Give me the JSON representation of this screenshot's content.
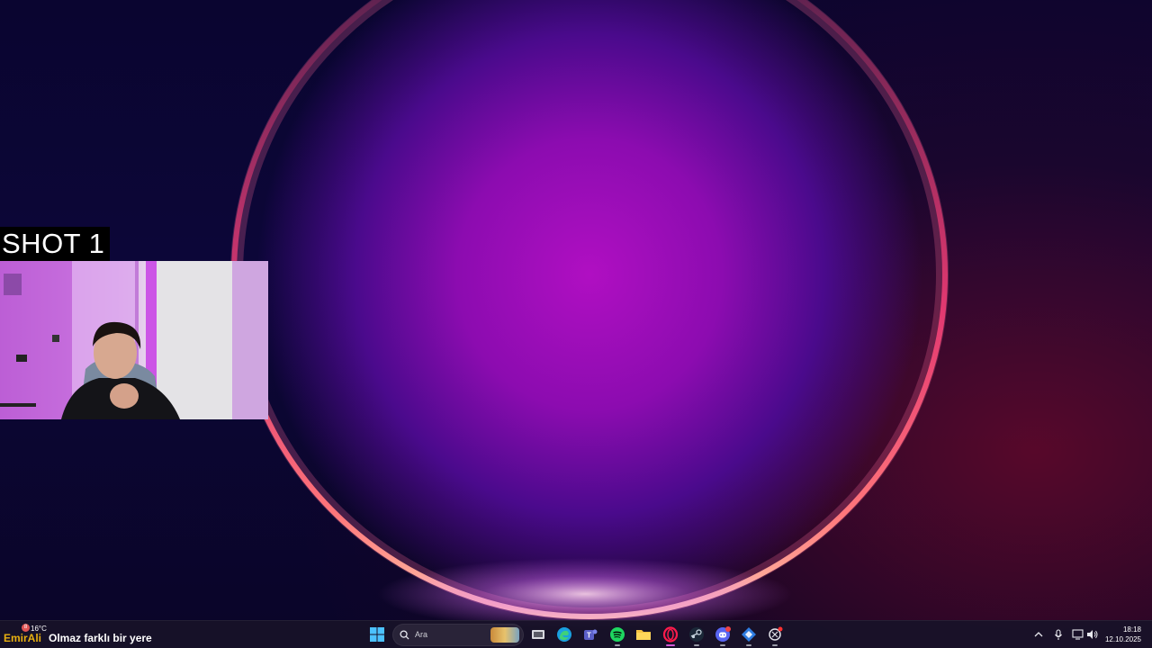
{
  "overlay": {
    "shot_label": "SHOT 1",
    "streamer_name": "EmirAli",
    "now_playing": "Olmaz farklı bir yere"
  },
  "weather": {
    "temperature": "16°C",
    "badge": "8"
  },
  "taskbar": {
    "search_placeholder": "Ara",
    "apps": [
      {
        "name": "start",
        "icon": "windows-icon"
      },
      {
        "name": "task-view",
        "icon": "task-view-icon"
      },
      {
        "name": "edge",
        "icon": "edge-icon"
      },
      {
        "name": "teams",
        "icon": "teams-icon"
      },
      {
        "name": "spotify",
        "icon": "spotify-icon"
      },
      {
        "name": "file-explorer",
        "icon": "folder-icon"
      },
      {
        "name": "opera-gx",
        "icon": "opera-icon"
      },
      {
        "name": "steam",
        "icon": "steam-icon"
      },
      {
        "name": "discord",
        "icon": "discord-icon",
        "badge": "9+"
      },
      {
        "name": "app-blue",
        "icon": "app-icon"
      },
      {
        "name": "chatgpt",
        "icon": "chatgpt-icon"
      }
    ]
  },
  "clock": {
    "time": "18:18",
    "date": "12.10.2025"
  },
  "colors": {
    "accent": "#d35ad6",
    "wallpaper_core": "#b00fc2",
    "overlay_name": "#e8b010"
  }
}
